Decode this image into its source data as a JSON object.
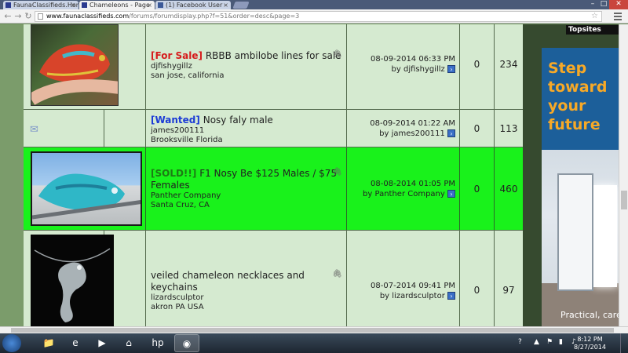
{
  "browser": {
    "tabs": [
      {
        "title": "FaunaClassifieds.Hom",
        "active": false
      },
      {
        "title": "Chameleons - Page",
        "active": true
      },
      {
        "title": "(1) Facebook User -",
        "active": false
      }
    ],
    "url_domain": "www.faunaclassifieds.com",
    "url_path": "/forums/forumdisplay.php?f=51&order=desc&page=3",
    "tab_close": "×"
  },
  "threads": [
    {
      "prefix": "[For Sale]",
      "prefix_type": "sale",
      "title": "RBBB ambilobe lines for sale",
      "author": "djfishygillz",
      "location": "san jose, california",
      "last_post_date": "08-09-2014 06:33 PM",
      "last_post_by": "by djfishygillz",
      "replies": "0",
      "views": "234"
    },
    {
      "prefix": "[Wanted]",
      "prefix_type": "wanted",
      "title": "Nosy faly male",
      "author": "james200111",
      "location": "Brooksville Florida",
      "last_post_date": "08-09-2014 01:22 AM",
      "last_post_by": "by james200111",
      "replies": "0",
      "views": "113"
    },
    {
      "prefix": "[SOLD!!]",
      "prefix_type": "sold",
      "title": "F1 Nosy Be $125 Males / $75 Females",
      "author": "Panther Company",
      "location": "Santa Cruz, CA",
      "last_post_date": "08-08-2014 01:05 PM",
      "last_post_by": "by Panther Company",
      "replies": "0",
      "views": "460"
    },
    {
      "prefix": "",
      "prefix_type": "none",
      "title": "veiled chameleon necklaces and keychains",
      "author": "lizardsculptor",
      "location": "akron PA USA",
      "last_post_date": "08-07-2014 09:41 PM",
      "last_post_by": "by lizardsculptor",
      "replies": "0",
      "views": "97"
    }
  ],
  "sidebar": {
    "topsites": "Topsites",
    "ad_headline": "Step toward your future",
    "ad_tagline": "Practical, caree"
  },
  "taskbar": {
    "time": "8:12 PM",
    "date": "8/27/2014"
  }
}
